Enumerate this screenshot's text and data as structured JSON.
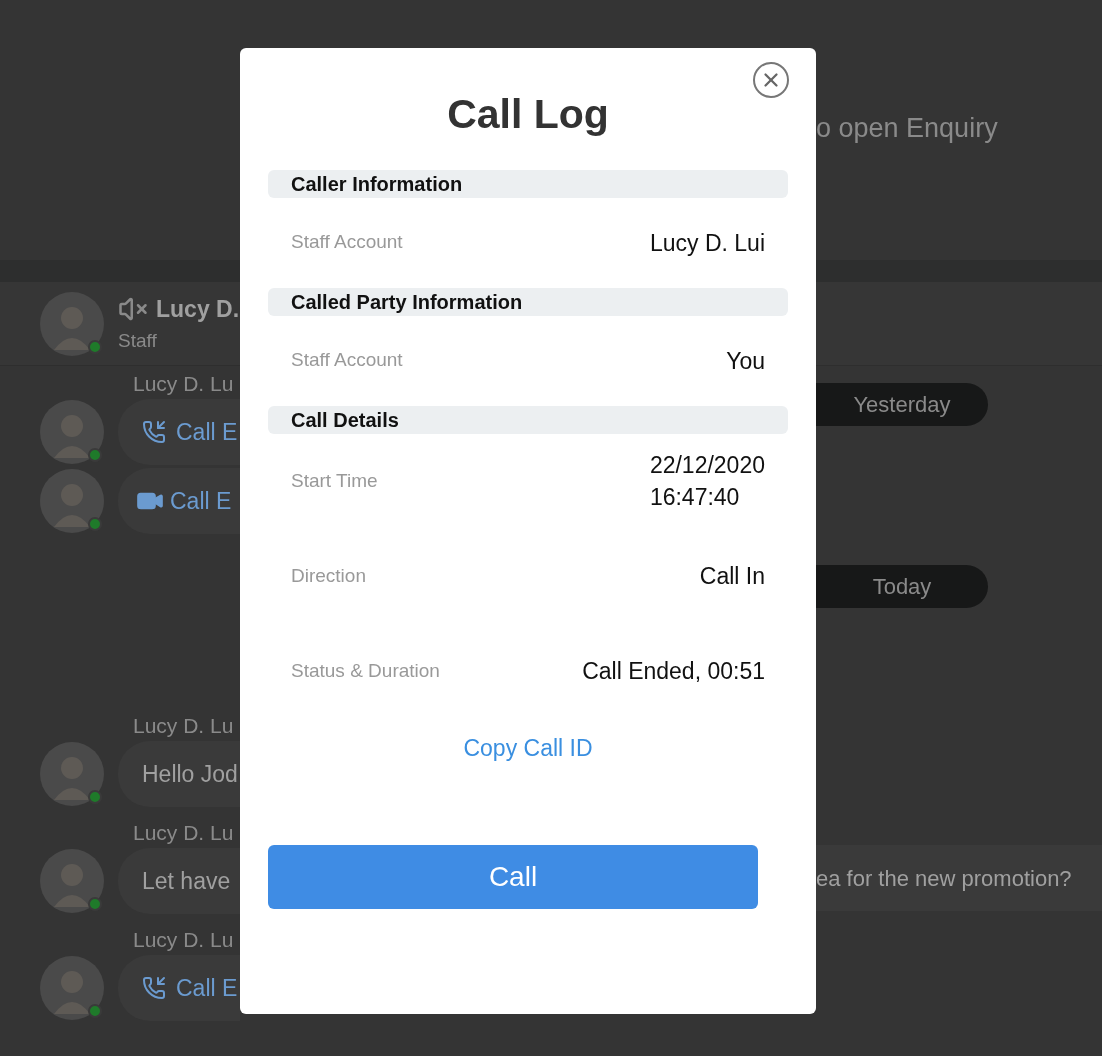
{
  "background": {
    "banner_text": "o open Enquiry",
    "chat_header": {
      "name": "Lucy D.",
      "role": "Staff"
    },
    "left_messages": [
      {
        "sender": "Lucy D. Lu",
        "kind": "call",
        "text": "Call E"
      },
      {
        "kind": "video",
        "text": "Call E"
      },
      {
        "sender": "Lucy D. Lu",
        "kind": "text",
        "text": "Hello Jod"
      },
      {
        "sender": "Lucy D. Lu",
        "kind": "text",
        "text": "Let have"
      },
      {
        "sender": "Lucy D. Lu",
        "kind": "call",
        "text": "Call E"
      }
    ],
    "date_pills": [
      "Yesterday",
      "Today"
    ],
    "right_message": "ea for the new promotion?"
  },
  "dialog": {
    "title": "Call Log",
    "sections": [
      {
        "title": "Caller Information",
        "rows": [
          {
            "label": "Staff Account",
            "value": [
              "Lucy D. Lui"
            ]
          }
        ]
      },
      {
        "title": "Called Party Information",
        "rows": [
          {
            "label": "Staff Account",
            "value": [
              "You"
            ]
          }
        ]
      },
      {
        "title": "Call Details",
        "rows": [
          {
            "label": "Start Time",
            "value": [
              "22/12/2020",
              "16:47:40"
            ]
          },
          {
            "label": "Direction",
            "value": [
              "Call In"
            ]
          },
          {
            "label": "Status & Duration",
            "value": [
              "Call Ended, 00:51"
            ]
          }
        ]
      }
    ],
    "link": "Copy Call ID",
    "button": "Call"
  }
}
